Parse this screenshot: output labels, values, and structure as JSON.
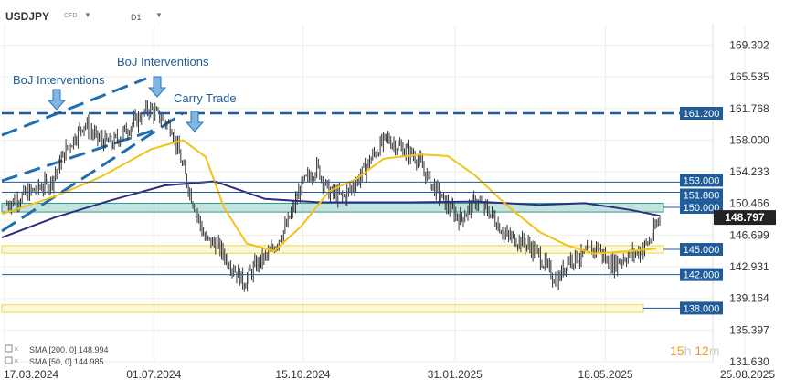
{
  "header": {
    "symbol": "USDJPY",
    "type": "CFD",
    "timeframe": "D1"
  },
  "chart_data": {
    "type": "candlestick",
    "y_ticks": [
      "169.302",
      "165.535",
      "161.768",
      "158.000",
      "154.233",
      "150.466",
      "146.699",
      "142.931",
      "139.164",
      "135.397",
      "131.630"
    ],
    "x_ticks": [
      "17.03.2024",
      "01.07.2024",
      "15.10.2024",
      "31.01.2025",
      "18.05.2025",
      "25.08.2025"
    ],
    "ylim": [
      131.63,
      171.8
    ],
    "current_price": "148.797",
    "levels": [
      {
        "value": 161.2,
        "label": "161.200",
        "style": "dashed",
        "color": "#1f5c99"
      },
      {
        "value": 153.0,
        "label": "153.000",
        "style": "solid",
        "color": "#1f5c99"
      },
      {
        "value": 151.8,
        "label": "151.800",
        "style": "solid",
        "color": "#1f5c99"
      },
      {
        "value": 150.0,
        "label": "150.000",
        "style": "zone",
        "color": "#2e9b8a"
      },
      {
        "value": 145.0,
        "label": "145.000",
        "style": "zone",
        "color": "#e8d94a"
      },
      {
        "value": 142.0,
        "label": "142.000",
        "style": "solid",
        "color": "#1f5c99"
      },
      {
        "value": 138.0,
        "label": "138.000",
        "style": "zone",
        "color": "#e8d94a"
      }
    ],
    "annotations": [
      "BoJ Interventions",
      "BoJ Interventions",
      "Carry Trade"
    ],
    "indicators": [
      {
        "label": "SMA [200, 0]",
        "value": "148.994",
        "color": "#2b2f7e"
      },
      {
        "label": "SMA [50, 0]",
        "value": "144.985",
        "color": "#f2c318"
      }
    ],
    "countdown": {
      "hours": "15",
      "h": "h",
      "minutes": "12",
      "m": "m"
    }
  }
}
